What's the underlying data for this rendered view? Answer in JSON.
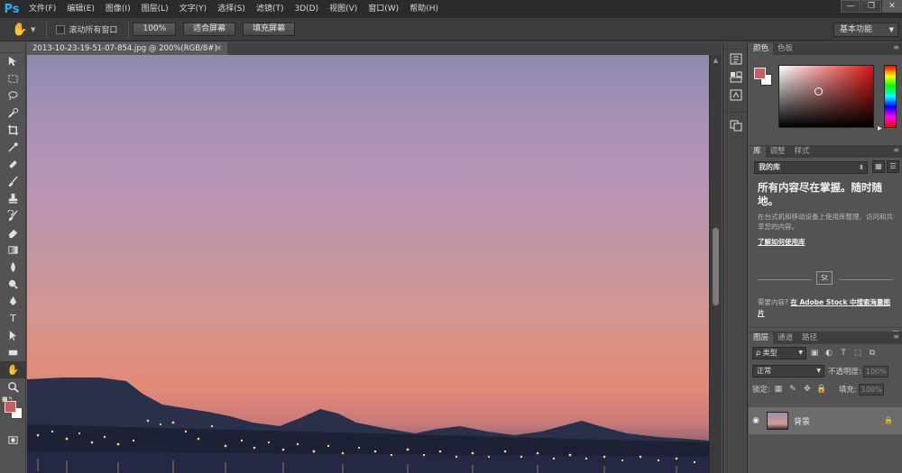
{
  "app": {
    "logo": "Ps",
    "menu": [
      "文件(F)",
      "编辑(E)",
      "图像(I)",
      "图层(L)",
      "文字(Y)",
      "选择(S)",
      "滤镜(T)",
      "3D(D)",
      "视图(V)",
      "窗口(W)",
      "帮助(H)"
    ],
    "window_controls": [
      "—",
      "❐",
      "✕"
    ]
  },
  "options": {
    "scroll_all_label": "滚动所有窗口",
    "zoom_100": "100%",
    "fit_screen": "适合屏幕",
    "fill_screen": "填充屏幕",
    "workspace": "基本功能"
  },
  "document": {
    "tab_title": "2013-10-23-19-51-07-854.jpg @ 200%(RGB/8#)",
    "close": "×"
  },
  "panels": {
    "color_tabs": [
      "颜色",
      "色板"
    ],
    "lib_tabs": [
      "库",
      "调整",
      "样式"
    ],
    "library": {
      "selected": "我的库",
      "heading": "所有内容尽在掌握。随时随地。",
      "desc": "在台式机和移动设备上使用库整理、访问和共享您的内容。",
      "learn_link": "了解如何使用库",
      "stock_badge": "St",
      "need_prefix": "需要内容?",
      "need_link": "在 Adobe Stock 中搜索海量图片"
    },
    "layer_tabs": [
      "图层",
      "通道",
      "路径"
    ],
    "layers": {
      "kind": "ρ 类型",
      "blend": "正常",
      "opacity_label": "不透明度:",
      "opacity_value": "100%",
      "lock_label": "锁定:",
      "fill_label": "填充:",
      "fill_value": "100%",
      "layer_name": "背景"
    }
  },
  "colors": {
    "foreground": "#c45e61",
    "background": "#ffffff"
  }
}
